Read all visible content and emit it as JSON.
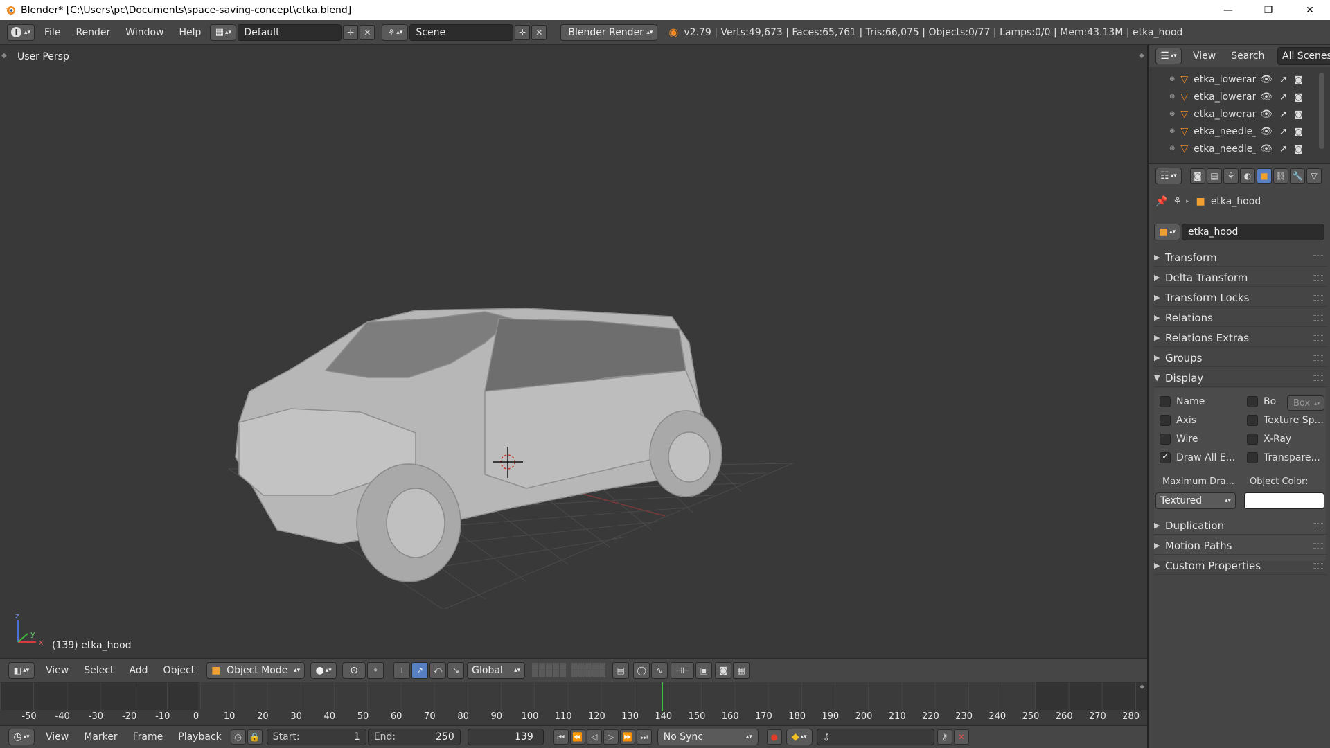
{
  "window": {
    "title": "Blender* [C:\\Users\\pc\\Documents\\space-saving-concept\\etka.blend]",
    "minimize": "—",
    "maximize": "❐",
    "close": "✕"
  },
  "infobar": {
    "menus": [
      "File",
      "Render",
      "Window",
      "Help"
    ],
    "layout_name": "Default",
    "scene_name": "Scene",
    "render_engine": "Blender Render",
    "stats": "v2.79 | Verts:49,673 | Faces:65,761 | Tris:66,075 | Objects:0/77 | Lamps:0/0 | Mem:43.13M | etka_hood"
  },
  "viewport": {
    "view_label": "User Persp",
    "object_label": "(139) etka_hood",
    "axis_z": "z",
    "axis_y": "y",
    "axis_x": "x"
  },
  "viewport_header": {
    "menus": [
      "View",
      "Select",
      "Add",
      "Object"
    ],
    "mode": "Object Mode",
    "orientation": "Global"
  },
  "timeline": {
    "ticks": [
      "-50",
      "-40",
      "-30",
      "-20",
      "-10",
      "0",
      "10",
      "20",
      "30",
      "40",
      "50",
      "60",
      "70",
      "80",
      "90",
      "100",
      "110",
      "120",
      "130",
      "140",
      "150",
      "160",
      "170",
      "180",
      "190",
      "200",
      "210",
      "220",
      "230",
      "240",
      "250",
      "260",
      "270",
      "280"
    ],
    "current_frame_marker": 139
  },
  "timeline_header": {
    "menus": [
      "View",
      "Marker",
      "Frame",
      "Playback"
    ],
    "start_label": "Start:",
    "start_value": "1",
    "end_label": "End:",
    "end_value": "250",
    "current_frame": "139",
    "sync": "No Sync"
  },
  "outliner": {
    "menus": [
      "View",
      "Search"
    ],
    "active_tab": "All Scenes",
    "items": [
      "etka_lowerarm",
      "etka_lowerarm",
      "etka_lowerarm",
      "etka_needle_",
      "etka_needle_"
    ]
  },
  "properties": {
    "context_object": "etka_hood",
    "object_name": "etka_hood",
    "panels_top": [
      "Transform",
      "Delta Transform",
      "Transform Locks",
      "Relations",
      "Relations Extras",
      "Groups"
    ],
    "display_panel": "Display",
    "display": {
      "name": "Name",
      "axis": "Axis",
      "wire": "Wire",
      "draw_all_edges": "Draw All E...",
      "bounds": "Bo",
      "bounds_type": "Box",
      "texture_space": "Texture Sp...",
      "xray": "X-Ray",
      "transparency": "Transpare...",
      "max_draw_label": "Maximum Dra...",
      "object_color_label": "Object Color:",
      "max_draw_value": "Textured",
      "draw_all_edges_checked": true,
      "object_color": "#ffffff"
    },
    "panels_bottom": [
      "Duplication",
      "Motion Paths",
      "Custom Properties"
    ]
  },
  "colors": {
    "accent_blue": "#5680c2",
    "playhead_green": "#3fbf3f",
    "active_tab_orange": "#e28f2d"
  }
}
